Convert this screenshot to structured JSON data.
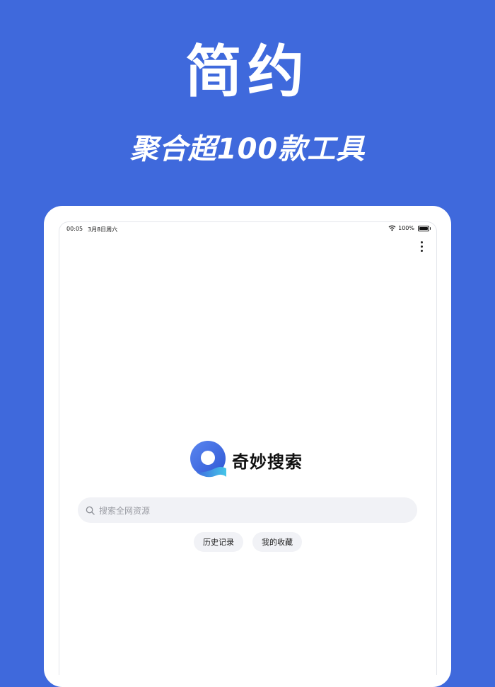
{
  "promo": {
    "headline": "简约",
    "subline": "聚合超100款工具"
  },
  "status_bar": {
    "time": "00:05",
    "date": "3月8日周六",
    "battery": "100%"
  },
  "app": {
    "name": "奇妙搜索",
    "brand_color": "#3f69dc",
    "search": {
      "placeholder": "搜索全网资源"
    },
    "chips": [
      {
        "label": "历史记录"
      },
      {
        "label": "我的收藏"
      }
    ],
    "menu_icon": "more-vertical-icon"
  }
}
